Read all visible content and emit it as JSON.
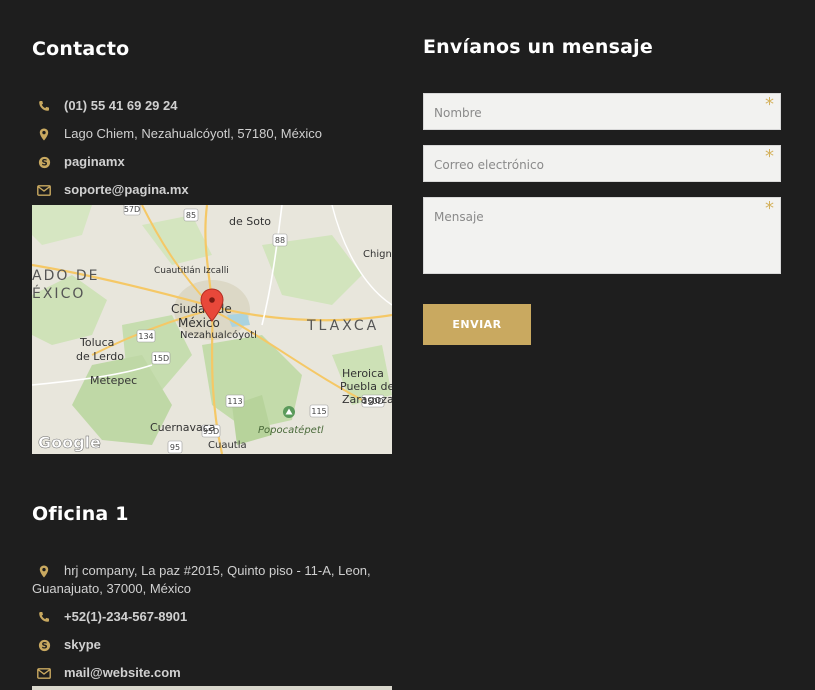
{
  "contact": {
    "title": "Contacto",
    "phone": "(01) 55 41 69 29 24",
    "address": "Lago Chiem, Nezahualcóyotl, 57180, México",
    "skype": "paginamx",
    "email": "soporte@pagina.mx"
  },
  "map": {
    "labels": {
      "soto": "de Soto",
      "ado": "ADO DE",
      "exico": "ÉXICO",
      "cuautitlan": "Cuautitlán Izcalli",
      "ciudad": "Ciudad de",
      "mexico": "México",
      "nezahualcoyotl": "Nezahualcóyotl",
      "tlaxca": "TLAXCA",
      "toluca": "Toluca",
      "de_lerdo": "de Lerdo",
      "metepec": "Metepec",
      "heroica": "Heroica",
      "puebla": "Puebla de",
      "zaragoza": "Zaragoza",
      "cuernavaca": "Cuernavaca",
      "popocatepetl": "Popocatépetl",
      "cuautla": "Cuautla",
      "chignahuapan": "Chign",
      "google": "Google",
      "routes": [
        "57D",
        "85",
        "88",
        "134",
        "15D",
        "113",
        "95D",
        "95",
        "150D",
        "115"
      ]
    }
  },
  "form": {
    "title": "Envíanos un mensaje",
    "name_placeholder": "Nombre",
    "email_placeholder": "Correo electrónico",
    "message_placeholder": "Mensaje",
    "required_mark": "*",
    "send_label": "ENVIAR"
  },
  "office": {
    "title": "Oficina 1",
    "address": "hrj company, La paz #2015, Quinto piso - 11-A, Leon, Guanajuato, 37000, México",
    "phone": "+52(1)-234-567-8901",
    "skype": "skype",
    "email": "mail@website.com"
  },
  "colors": {
    "background": "#1e1e1e",
    "accent": "#c9a960",
    "input_bg": "#f2f2f0"
  },
  "icons": [
    "phone-icon",
    "map-marker-icon",
    "skype-icon",
    "envelope-icon"
  ]
}
